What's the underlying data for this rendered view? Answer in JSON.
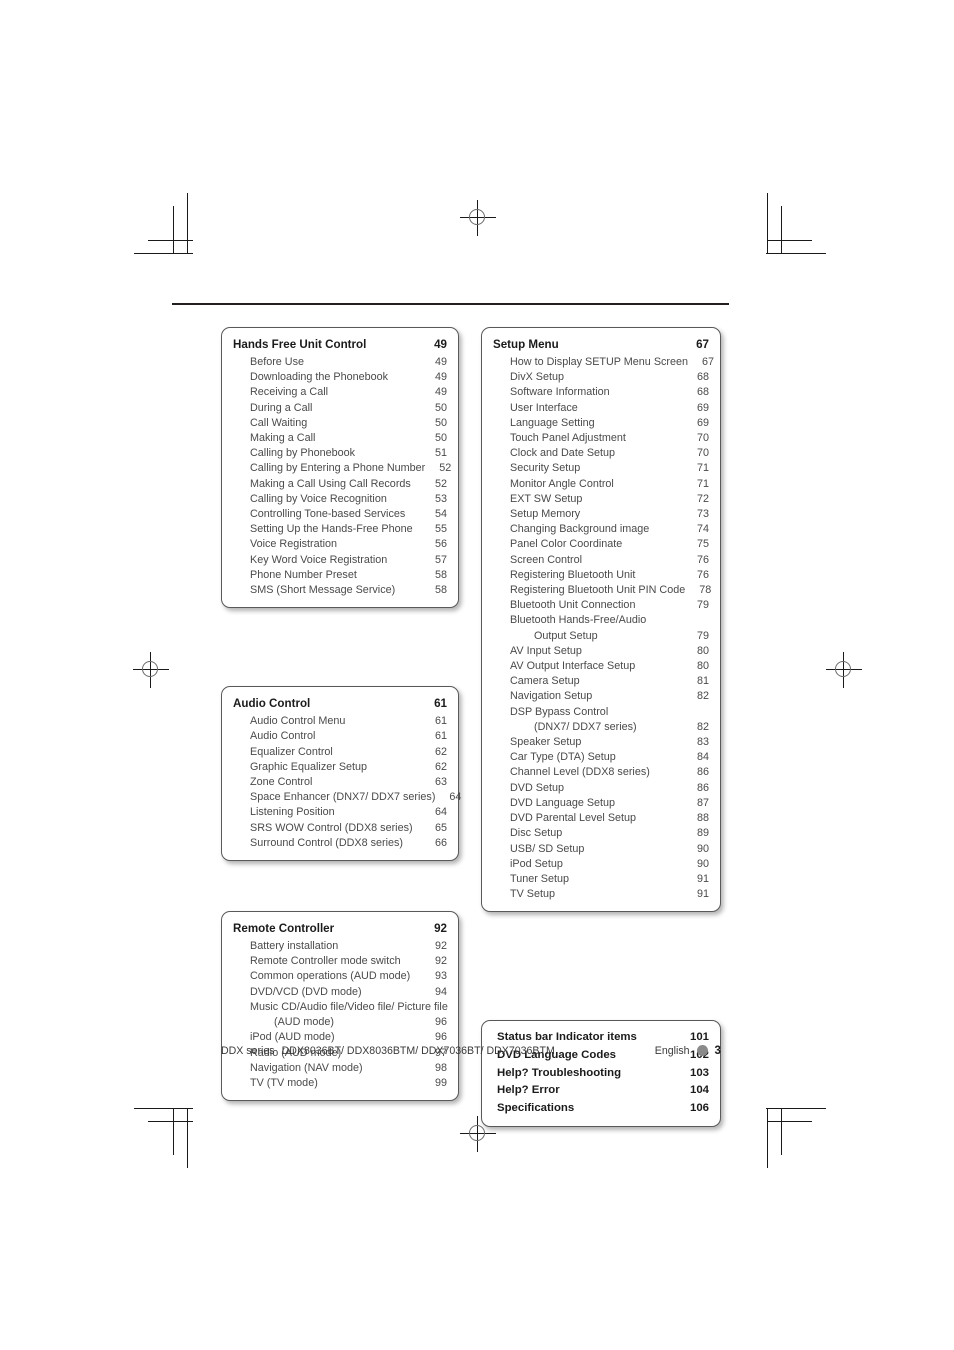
{
  "footer": {
    "series_label": "DDX series",
    "models": "DDX8036BT/ DDX8036BTM/ DDX7036BT/ DDX7036BTM",
    "language": "English",
    "page_number": "3"
  },
  "columns": {
    "left": [
      {
        "id": "hands-free-unit-control",
        "title": "Hands Free Unit Control",
        "page": "49",
        "entries": [
          {
            "label": "Before Use",
            "page": "49"
          },
          {
            "label": "Downloading the Phonebook",
            "page": "49"
          },
          {
            "label": "Receiving a Call",
            "page": "49"
          },
          {
            "label": "During a Call",
            "page": "50"
          },
          {
            "label": "Call Waiting",
            "page": "50"
          },
          {
            "label": "Making a Call",
            "page": "50"
          },
          {
            "label": "Calling by Phonebook",
            "page": "51"
          },
          {
            "label": "Calling by Entering a Phone Number",
            "page": "52"
          },
          {
            "label": "Making a Call Using Call Records",
            "page": "52"
          },
          {
            "label": "Calling by Voice Recognition",
            "page": "53"
          },
          {
            "label": "Controlling Tone-based Services",
            "page": "54"
          },
          {
            "label": "Setting Up the Hands-Free Phone",
            "page": "55"
          },
          {
            "label": "Voice Registration",
            "page": "56"
          },
          {
            "label": "Key Word Voice Registration",
            "page": "57"
          },
          {
            "label": "Phone Number Preset",
            "page": "58"
          },
          {
            "label": "SMS (Short Message Service)",
            "page": "58"
          }
        ]
      },
      {
        "id": "audio-control",
        "title": "Audio Control",
        "page": "61",
        "entries": [
          {
            "label": "Audio Control Menu",
            "page": "61"
          },
          {
            "label": "Audio Control",
            "page": "61"
          },
          {
            "label": "Equalizer Control",
            "page": "62"
          },
          {
            "label": "Graphic Equalizer Setup",
            "page": "62"
          },
          {
            "label": "Zone Control",
            "page": "63"
          },
          {
            "label": "Space Enhancer (DNX7/ DDX7 series)",
            "page": "64"
          },
          {
            "label": "Listening Position",
            "page": "64"
          },
          {
            "label": "SRS WOW Control (DDX8 series)",
            "page": "65"
          },
          {
            "label": "Surround Control (DDX8 series)",
            "page": "66"
          }
        ]
      },
      {
        "id": "remote-controller",
        "title": "Remote Controller",
        "page": "92",
        "entries": [
          {
            "label": "Battery installation",
            "page": "92"
          },
          {
            "label": "Remote Controller mode switch",
            "page": "92"
          },
          {
            "label": "Common operations (AUD mode)",
            "page": "93"
          },
          {
            "label": "DVD/VCD (DVD mode)",
            "page": "94"
          },
          {
            "label": "Music CD/Audio file/Video file/ Picture file",
            "page": "",
            "wrap": true
          },
          {
            "label": "(AUD mode)",
            "page": "96",
            "cont": true
          },
          {
            "label": "iPod (AUD mode)",
            "page": "96"
          },
          {
            "label": "Radio (AUD mode)",
            "page": "97"
          },
          {
            "label": "Navigation (NAV mode)",
            "page": "98"
          },
          {
            "label": "TV (TV mode)",
            "page": "99"
          }
        ]
      }
    ],
    "right": [
      {
        "id": "setup-menu",
        "title": "Setup Menu",
        "page": "67",
        "entries": [
          {
            "label": "How to Display SETUP Menu Screen",
            "page": "67"
          },
          {
            "label": "DivX Setup",
            "page": "68"
          },
          {
            "label": "Software Information",
            "page": "68"
          },
          {
            "label": "User Interface",
            "page": "69"
          },
          {
            "label": "Language Setting",
            "page": "69"
          },
          {
            "label": "Touch Panel Adjustment",
            "page": "70"
          },
          {
            "label": "Clock and Date Setup",
            "page": "70"
          },
          {
            "label": "Security Setup",
            "page": "71"
          },
          {
            "label": "Monitor Angle Control",
            "page": "71"
          },
          {
            "label": "EXT SW Setup",
            "page": "72"
          },
          {
            "label": "Setup Memory",
            "page": "73"
          },
          {
            "label": "Changing Background image",
            "page": "74"
          },
          {
            "label": "Panel Color Coordinate",
            "page": "75"
          },
          {
            "label": "Screen Control",
            "page": "76"
          },
          {
            "label": "Registering Bluetooth Unit",
            "page": "76"
          },
          {
            "label": "Registering Bluetooth Unit PIN Code",
            "page": "78"
          },
          {
            "label": "Bluetooth Unit Connection",
            "page": "79"
          },
          {
            "label": "Bluetooth Hands-Free/Audio",
            "page": "",
            "wrap": true
          },
          {
            "label": "Output Setup",
            "page": "79",
            "cont": true
          },
          {
            "label": "AV Input Setup",
            "page": "80"
          },
          {
            "label": "AV Output Interface Setup",
            "page": "80"
          },
          {
            "label": "Camera Setup",
            "page": "81"
          },
          {
            "label": "Navigation Setup",
            "page": "82"
          },
          {
            "label": "DSP Bypass Control",
            "page": "",
            "wrap": true
          },
          {
            "label": "(DNX7/ DDX7 series)",
            "page": "82",
            "cont": true
          },
          {
            "label": "Speaker Setup",
            "page": "83"
          },
          {
            "label": "Car Type (DTA) Setup",
            "page": "84"
          },
          {
            "label": "Channel Level (DDX8 series)",
            "page": "86"
          },
          {
            "label": "DVD Setup",
            "page": "86"
          },
          {
            "label": "DVD Language Setup",
            "page": "87"
          },
          {
            "label": "DVD Parental Level Setup",
            "page": "88"
          },
          {
            "label": "Disc Setup",
            "page": "89"
          },
          {
            "label": "USB/ SD Setup",
            "page": "90"
          },
          {
            "label": "iPod Setup",
            "page": "90"
          },
          {
            "label": "Tuner Setup",
            "page": "91"
          },
          {
            "label": "TV Setup",
            "page": "91"
          }
        ]
      },
      {
        "id": "appendix-summary",
        "title": "",
        "page": "",
        "bold_list": true,
        "entries": [
          {
            "label": "Status bar Indicator items",
            "page": "101"
          },
          {
            "label": "DVD Language Codes",
            "page": "102"
          },
          {
            "label": "Help? Troubleshooting",
            "page": "103"
          },
          {
            "label": "Help? Error",
            "page": "104"
          },
          {
            "label": "Specifications",
            "page": "106"
          }
        ]
      }
    ]
  }
}
